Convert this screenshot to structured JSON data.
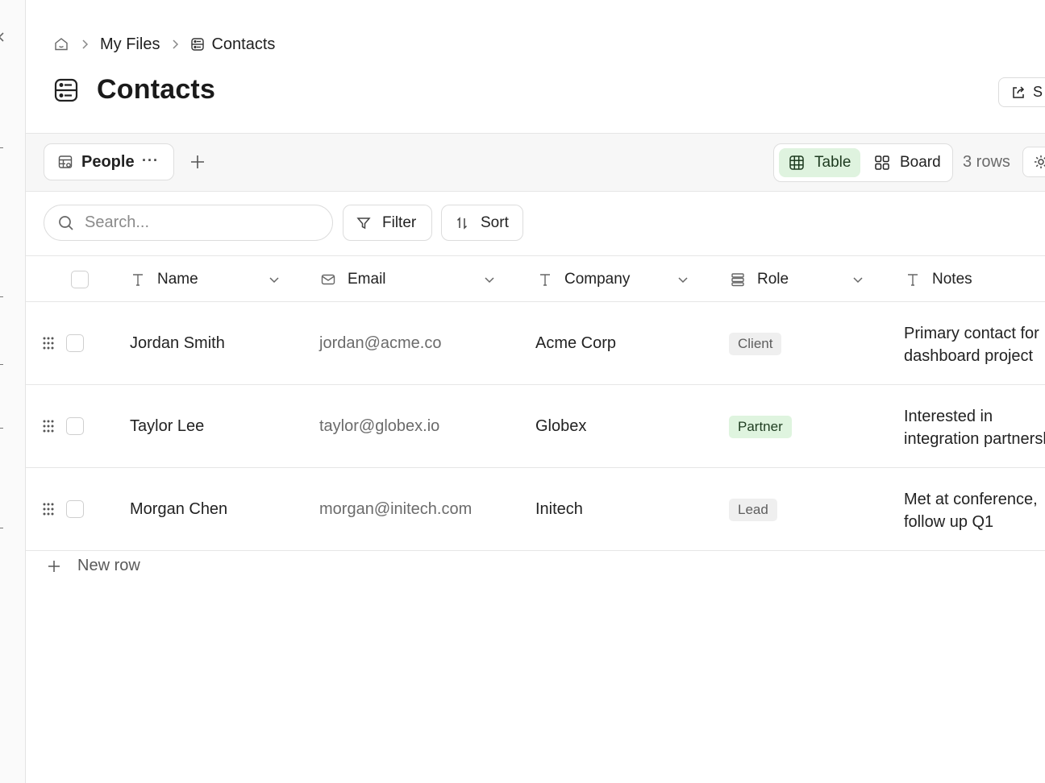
{
  "breadcrumb": {
    "my_files": "My Files",
    "current": "Contacts"
  },
  "page": {
    "title": "Contacts",
    "share_label": "S"
  },
  "views": {
    "active_view": "People",
    "more": "···",
    "table_label": "Table",
    "board_label": "Board",
    "row_count": "3 rows"
  },
  "toolbar": {
    "search_placeholder": "Search...",
    "filter_label": "Filter",
    "sort_label": "Sort"
  },
  "columns": {
    "name": {
      "label": "Name",
      "icon": "text-type-icon"
    },
    "email": {
      "label": "Email",
      "icon": "mail-icon"
    },
    "company": {
      "label": "Company",
      "icon": "text-type-icon"
    },
    "role": {
      "label": "Role",
      "icon": "select-icon"
    },
    "notes": {
      "label": "Notes",
      "icon": "text-type-icon"
    }
  },
  "rows": [
    {
      "name": "Jordan Smith",
      "email": "jordan@acme.co",
      "company": "Acme Corp",
      "role": "Client",
      "role_color": "#efefef",
      "notes": "Primary contact for dashboard project"
    },
    {
      "name": "Taylor Lee",
      "email": "taylor@globex.io",
      "company": "Globex",
      "role": "Partner",
      "role_color": "#dff4df",
      "notes": "Interested in integration partnership"
    },
    {
      "name": "Morgan Chen",
      "email": "morgan@initech.com",
      "company": "Initech",
      "role": "Lead",
      "role_color": "#efefef",
      "notes": "Met at conference, follow up Q1"
    }
  ],
  "footer": {
    "new_row_label": "New row"
  },
  "colors": {
    "accent_green": "#dff3df",
    "border": "#e6e6e6"
  }
}
